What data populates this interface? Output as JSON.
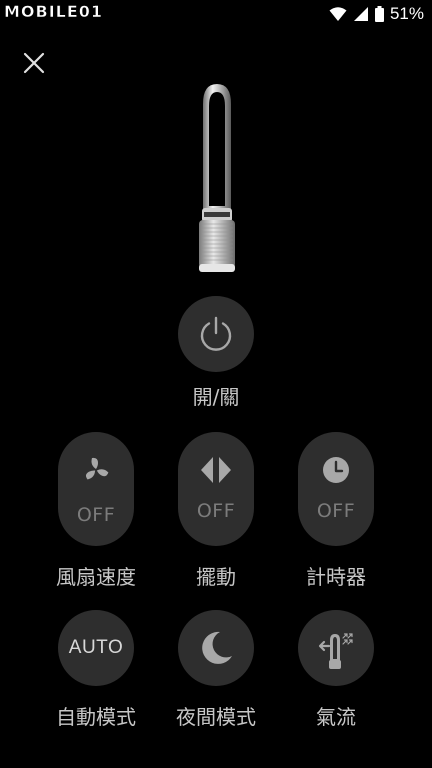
{
  "status_bar": {
    "watermark": "MOBILE01",
    "battery": "51%"
  },
  "icons": {
    "close": "close-icon",
    "power": "power-icon",
    "fan_speed": "fan-icon",
    "oscillation": "oscillation-icon",
    "timer": "clock-icon",
    "night_mode": "moon-icon",
    "airflow": "airflow-icon"
  },
  "power": {
    "label": "開/關"
  },
  "controls": {
    "fan_speed": {
      "label": "風扇速度",
      "state": "OFF"
    },
    "oscillation": {
      "label": "擺動",
      "state": "OFF"
    },
    "timer": {
      "label": "計時器",
      "state": "OFF"
    },
    "auto_mode": {
      "label": "自動模式",
      "button_text": "AUTO"
    },
    "night_mode": {
      "label": "夜間模式"
    },
    "airflow": {
      "label": "氣流"
    }
  },
  "colors": {
    "background": "#000000",
    "button": "#2e2e2e",
    "icon": "#a8a8a8",
    "state_text": "#7c7c7c",
    "label_text": "#c7c7c7"
  }
}
